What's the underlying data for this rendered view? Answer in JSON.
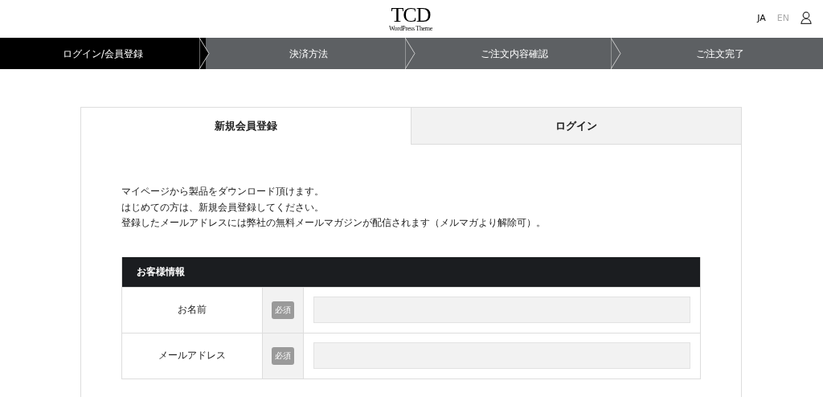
{
  "header": {
    "logo": "TCD",
    "logo_subtitle": "WordPress Theme",
    "languages": [
      {
        "label": "JA",
        "selected": true
      },
      {
        "label": "EN",
        "selected": false
      }
    ]
  },
  "steps": [
    {
      "label": "ログイン/会員登録",
      "selected": true
    },
    {
      "label": "決済方法",
      "selected": false
    },
    {
      "label": "ご注文内容確認",
      "selected": false
    },
    {
      "label": "ご注文完了",
      "selected": false
    }
  ],
  "tabs": [
    {
      "label": "新規会員登録",
      "selected": true
    },
    {
      "label": "ログイン",
      "selected": false
    }
  ],
  "intro": [
    "マイページから製品をダウンロード頂けます。",
    "はじめての方は、新規会員登録してください。",
    "登録したメールアドレスには弊社の無料メールマガジンが配信されます（メルマガより解除可）。"
  ],
  "form": {
    "title": "お客様情報",
    "rows": [
      {
        "label": "お名前",
        "required": "必須"
      },
      {
        "label": "メールアドレス",
        "required": "必須"
      }
    ]
  }
}
